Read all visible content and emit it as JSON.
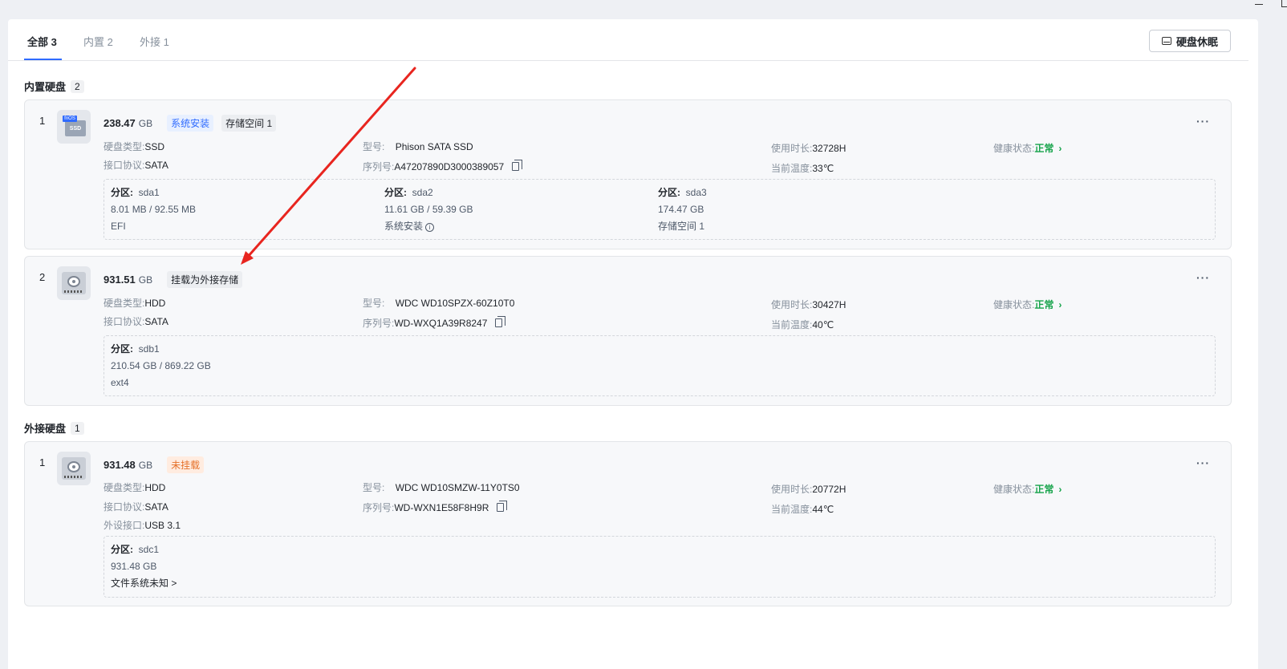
{
  "window": {
    "minimize_label": "—"
  },
  "tabs": [
    {
      "label": "全部 3"
    },
    {
      "label": "内置 2"
    },
    {
      "label": "外接 1"
    }
  ],
  "sleep_button": {
    "label": "硬盘休眠"
  },
  "sections": {
    "internal": {
      "title": "内置硬盘",
      "count": "2"
    },
    "external": {
      "title": "外接硬盘",
      "count": "1"
    }
  },
  "labels": {
    "type": "硬盘类型:",
    "protocol": "接口协议:",
    "model": "型号:",
    "serial": "序列号:",
    "uptime": "使用时长:",
    "temp": "当前温度:",
    "health": "健康状态:",
    "usb": "外设接口:",
    "partition": "分区:",
    "more": "···"
  },
  "disks": [
    {
      "index": "1",
      "icon_label": "SSD",
      "icon_tag": "fnOS",
      "capacity": "238.47",
      "unit": "GB",
      "tags": [
        "系统安装",
        "存储空间 1"
      ],
      "type": "SSD",
      "protocol": "SATA",
      "model": "Phison SATA SSD",
      "serial": "A47207890D3000389057",
      "uptime": "32728H",
      "temp": "33℃",
      "health": "正常",
      "partitions": [
        {
          "name": "sda1",
          "size": "8.01 MB / 92.55 MB",
          "fs": "EFI"
        },
        {
          "name": "sda2",
          "size": "11.61 GB / 59.39 GB",
          "fs": "系统安装"
        },
        {
          "name": "sda3",
          "size": "174.47 GB",
          "fs": "存储空间 1"
        }
      ]
    },
    {
      "index": "2",
      "capacity": "931.51",
      "unit": "GB",
      "tags": [
        "挂载为外接存储"
      ],
      "type": "HDD",
      "protocol": "SATA",
      "model": "WDC WD10SPZX-60Z10T0",
      "serial": "WD-WXQ1A39R8247",
      "uptime": "30427H",
      "temp": "40℃",
      "health": "正常",
      "partitions": [
        {
          "name": "sdb1",
          "size": "210.54 GB / 869.22 GB",
          "fs": "ext4"
        }
      ]
    },
    {
      "index": "1",
      "capacity": "931.48",
      "unit": "GB",
      "tags": [
        "未挂载"
      ],
      "type": "HDD",
      "protocol": "SATA",
      "usb": "USB 3.1",
      "model": "WDC WD10SMZW-11Y0TS0",
      "serial": "WD-WXN1E58F8H9R",
      "uptime": "20772H",
      "temp": "44℃",
      "health": "正常",
      "partitions": [
        {
          "name": "sdc1",
          "size": "931.48 GB",
          "fs": "文件系统未知 >"
        }
      ]
    }
  ],
  "colors": {
    "accent": "#2f6bff",
    "ok": "#16a34a",
    "warn": "#e5712a",
    "annotation": "#e8251f"
  }
}
